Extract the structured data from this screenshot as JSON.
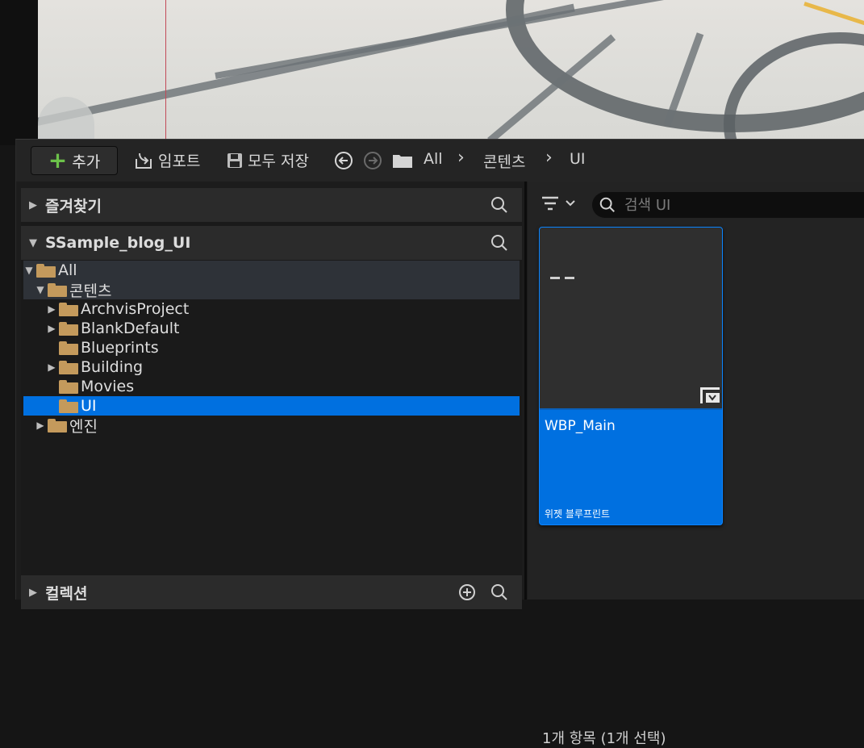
{
  "toolbar": {
    "add_label": "추가",
    "import_label": "임포트",
    "save_all_label": "모두 저장",
    "breadcrumb": [
      "All",
      "콘텐츠",
      "UI"
    ]
  },
  "left_panel": {
    "favorites_label": "즐겨찾기",
    "project_label": "SSample_blog_UI",
    "collections_label": "컬렉션",
    "tree": [
      {
        "label": "All",
        "expanded": true,
        "level": 0
      },
      {
        "label": "콘텐츠",
        "expanded": true,
        "level": 1
      },
      {
        "label": "ArchvisProject",
        "expanded": false,
        "level": 2
      },
      {
        "label": "BlankDefault",
        "expanded": false,
        "level": 2
      },
      {
        "label": "Blueprints",
        "level": 2
      },
      {
        "label": "Building",
        "expanded": false,
        "level": 2
      },
      {
        "label": "Movies",
        "level": 2
      },
      {
        "label": "UI",
        "level": 2,
        "selected": true
      },
      {
        "label": "엔진",
        "expanded": false,
        "level": 1
      }
    ]
  },
  "right_panel": {
    "search_placeholder": "검색 UI",
    "asset": {
      "name": "WBP_Main",
      "type": "위젯 블루프린트"
    },
    "status_text": "1개 항목 (1개 선택)"
  },
  "colors": {
    "selection": "#0070e0",
    "folder": "#c49a5c",
    "add_plus": "#6cc24a"
  }
}
